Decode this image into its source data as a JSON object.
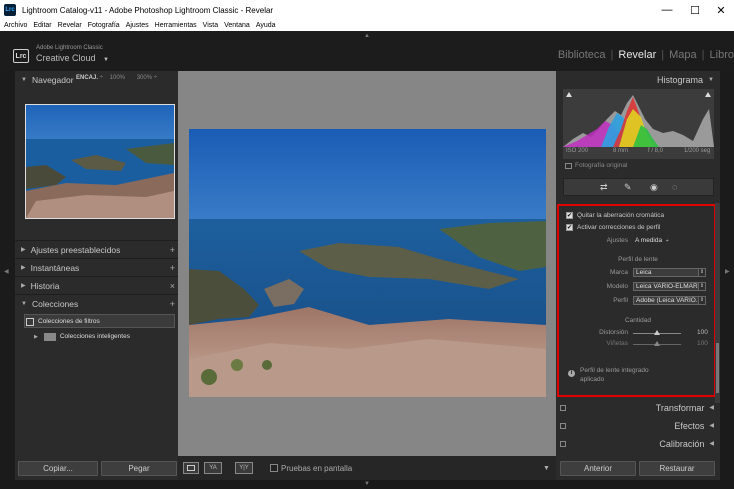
{
  "window": {
    "app_icon": "Lrc",
    "title": "Lightroom Catalog-v11 - Adobe Photoshop Lightroom Classic - Revelar",
    "controls": {
      "minimize": "—",
      "maximize": "☐",
      "close": "✕"
    }
  },
  "menu": [
    "Archivo",
    "Editar",
    "Revelar",
    "Fotografía",
    "Ajustes",
    "Herramientas",
    "Vista",
    "Ventana",
    "Ayuda"
  ],
  "identity": {
    "logo": "Lrc",
    "small": "Adobe Lightroom Classic",
    "big": "Creative Cloud",
    "caret": "▼"
  },
  "modules": {
    "items": [
      "Biblioteca",
      "Revelar",
      "Mapa",
      "Libro"
    ],
    "active": "Revelar"
  },
  "left_panel": {
    "navigator": {
      "title": "Navegador",
      "fit": "ENCAJ.",
      "fit_caret": "÷",
      "z1": "100%",
      "z2": "300%",
      "z2_caret": "÷"
    },
    "sections": [
      {
        "title": "Ajustes preestablecidos",
        "action": "+"
      },
      {
        "title": "Instantáneas",
        "action": "+"
      },
      {
        "title": "Historia",
        "action": "×"
      },
      {
        "title": "Colecciones",
        "action": "+"
      }
    ],
    "collections": [
      "Colecciones de filtros",
      "Colecciones inteligentes"
    ],
    "copy_button": "Copiar...",
    "paste_button": "Pegar"
  },
  "toolbar": {
    "ya": "YA",
    "yy": "Y|Y",
    "soft_proof": "Pruebas en pantalla"
  },
  "right_panel": {
    "histogram": {
      "title": "Histograma",
      "iso": "ISO 200",
      "focal": "8 mm",
      "aperture": "f / 8,0",
      "shutter": "1/200 seg",
      "original_label": "Fotografía original"
    },
    "lens": {
      "remove_ca": "Quitar la aberración cromática",
      "enable_profile": "Activar correcciones de perfil",
      "setup_label": "Ajustes",
      "setup_value": "A medida",
      "profile_title": "Perfil de lente",
      "make_label": "Marca",
      "make_value": "Leica",
      "model_label": "Modelo",
      "model_value": "Leica VARIO-ELMAR...",
      "profile_label": "Perfil",
      "profile_value": "Adobe (Leica VARIO...",
      "amount_title": "Cantidad",
      "distortion_label": "Distorsión",
      "distortion_value": "100",
      "vignette_label": "Viñetas",
      "vignette_value": "100",
      "note_line1": "Perfil de lente integrado",
      "note_line2": "aplicado"
    },
    "sections": [
      "Transformar",
      "Efectos",
      "Calibración"
    ],
    "previous_button": "Anterior",
    "reset_button": "Restaurar"
  },
  "colors": {
    "accent_border": "#e00000",
    "panel": "#2b2b2b",
    "canvas": "#868686"
  }
}
